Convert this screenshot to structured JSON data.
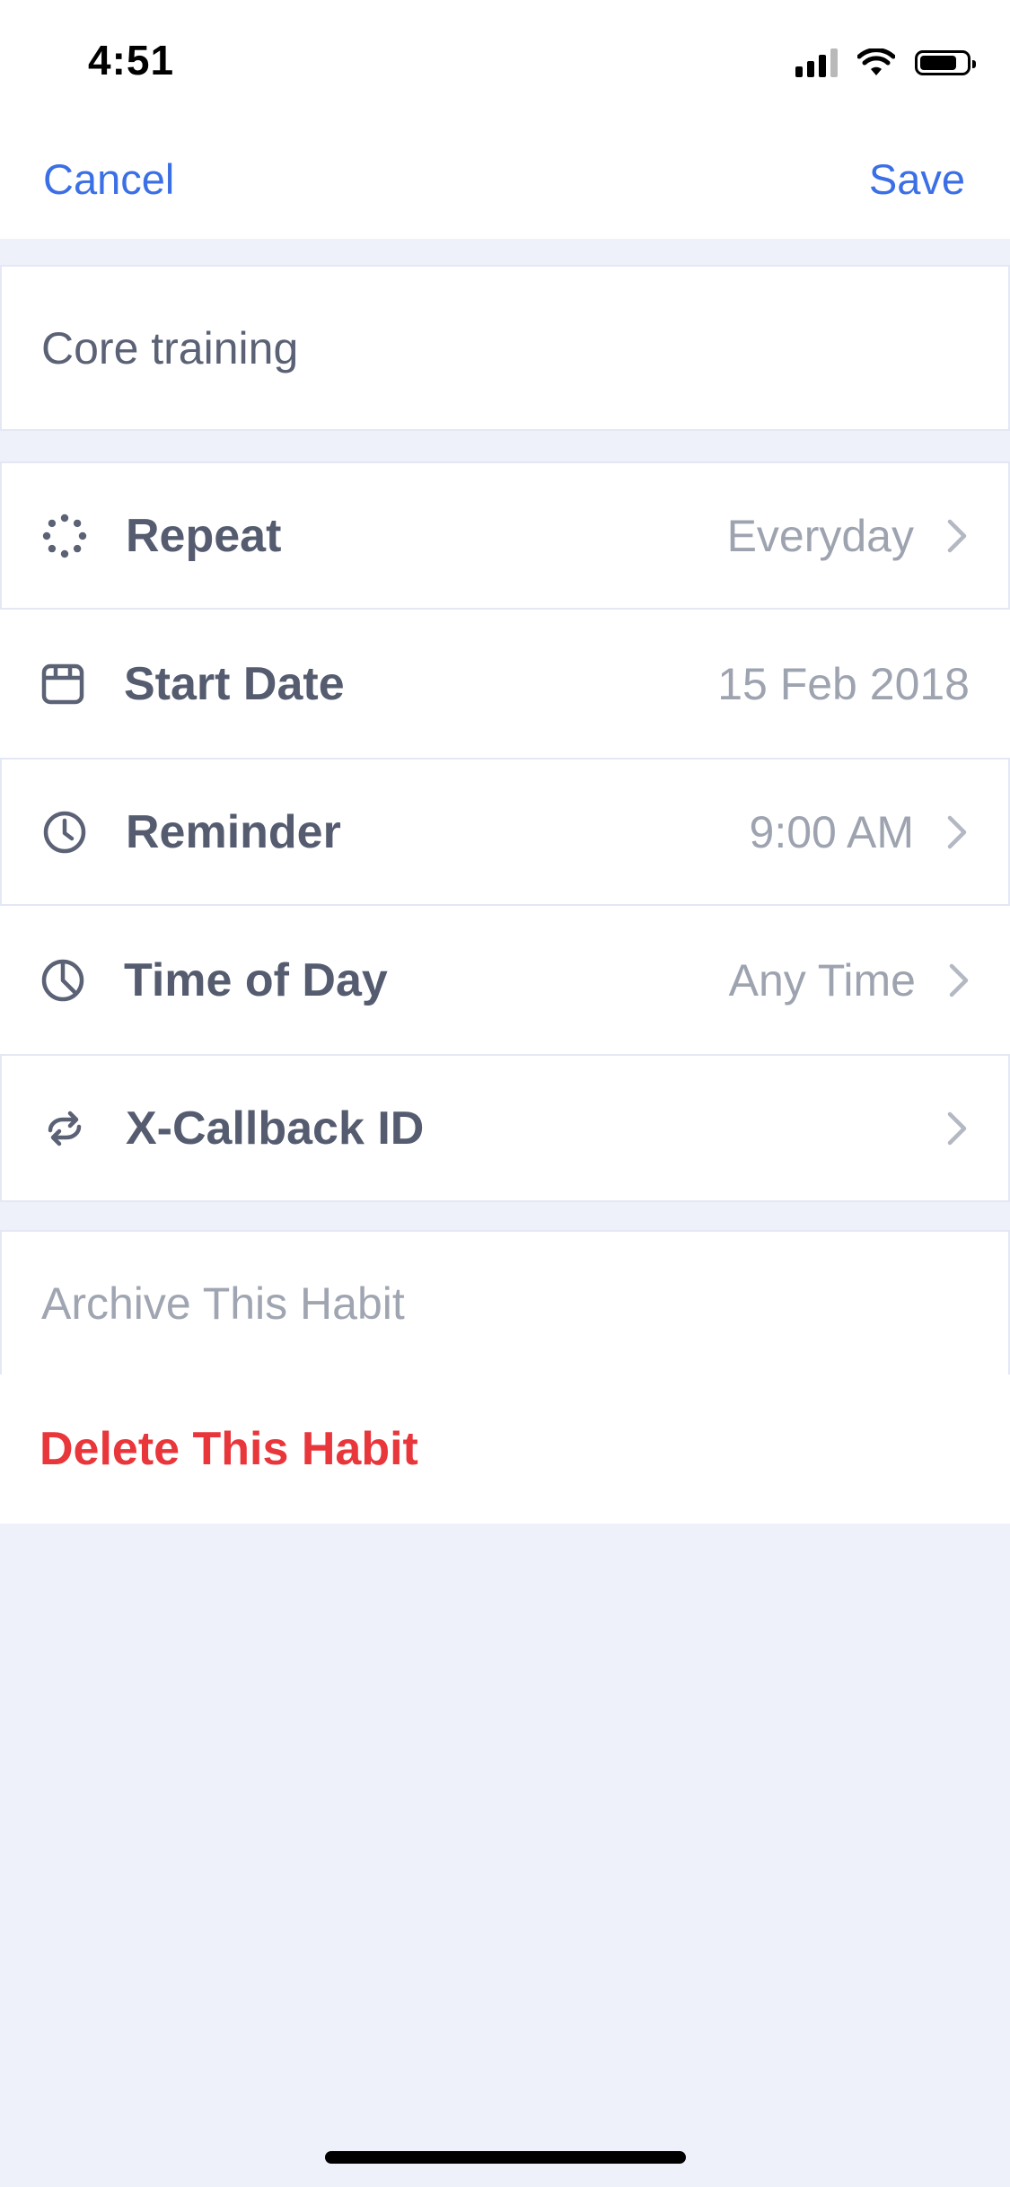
{
  "status_bar": {
    "time": "4:51",
    "signal_icon": "cellular-signal-icon",
    "wifi_icon": "wifi-icon",
    "battery_icon": "battery-icon",
    "battery_level": 0.8
  },
  "nav": {
    "cancel_label": "Cancel",
    "save_label": "Save"
  },
  "habit": {
    "name": "Core training"
  },
  "settings": [
    {
      "label": "Repeat",
      "value": "Everyday",
      "icon": "repeat-dashed-circle-icon",
      "chevron": true
    },
    {
      "label": "Start Date",
      "value": "15 Feb 2018",
      "icon": "calendar-icon",
      "chevron": false
    },
    {
      "label": "Reminder",
      "value": "9:00 AM",
      "icon": "clock-icon",
      "chevron": true
    },
    {
      "label": "Time of Day",
      "value": "Any Time",
      "icon": "pie-clock-icon",
      "chevron": true
    },
    {
      "label": "X-Callback ID",
      "value": "",
      "icon": "sync-arrows-icon",
      "chevron": true
    }
  ],
  "actions": {
    "archive_label": "Archive This Habit",
    "delete_label": "Delete This Habit"
  },
  "colors": {
    "accent": "#3b6fe6",
    "destructive": "#e8363b",
    "background": "#eef1f9",
    "row_text": "#555c70",
    "value_text": "#9ea3b0"
  }
}
